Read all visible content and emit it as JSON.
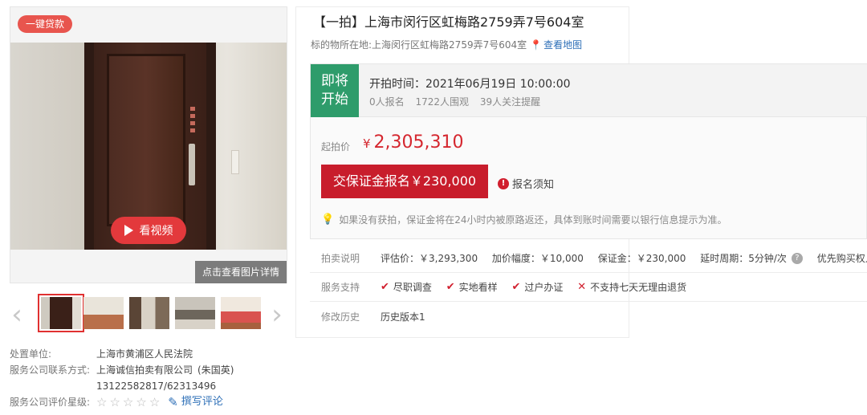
{
  "gallery": {
    "loan_badge": "一键贷款",
    "video_button": "看视频",
    "view_detail": "点击查看图片详情",
    "prev_arrow": "‹",
    "next_arrow": "›",
    "thumb_count": 5
  },
  "info": {
    "court_label": "处置单位:",
    "court_value": "上海市黄浦区人民法院",
    "company_label": "服务公司联系方式:",
    "company_value": "上海诚信拍卖有限公司",
    "company_contact": "(朱国英)",
    "phone": "13122582817/62313496",
    "rating_label": "服务公司评价星级:",
    "review_link": "撰写评论"
  },
  "listing": {
    "title": "【一拍】上海市闵行区虹梅路2759弄7号604室",
    "location_label": "标的物所在地:",
    "location_value": "上海闵行区虹梅路2759弄7号604室",
    "map_link": "查看地图"
  },
  "auction": {
    "status": "即将开始",
    "start_time": "开拍时间：2021年06月19日 10:00:00",
    "signups": "0人报名",
    "watchers": "1722人围观",
    "followers": "39人关注提醒",
    "price_label": "起拍价",
    "price_currency": "¥",
    "price_value": "2,305,310",
    "deposit_button": "交保证金报名￥230,000",
    "notice_link": "报名须知",
    "tip": "如果没有获拍，保证金将在24小时内被原路返还，具体到账时间需要以银行信息提示为准。"
  },
  "details": {
    "rules_label": "拍卖说明",
    "appraisal": "评估价：￥3,293,300",
    "increment": "加价幅度：￥10,000",
    "deposit": "保证金：￥230,000",
    "extension": "延时周期：5分钟/次",
    "priority": "优先购买权人：无",
    "service_label": "服务支持",
    "services": [
      "尽职调查",
      "实地看样",
      "过户办证"
    ],
    "no_return": "不支持七天无理由退货",
    "history_label": "修改历史",
    "history_value": "历史版本1"
  }
}
